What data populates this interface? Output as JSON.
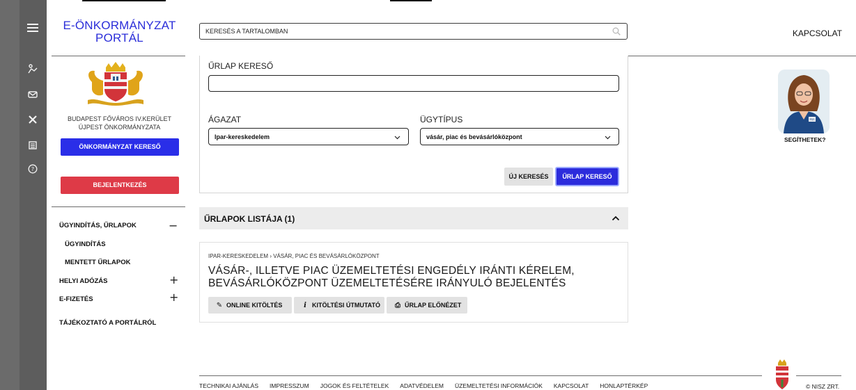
{
  "brand": {
    "line1": "E-ÖNKORMÁNYZAT",
    "line2": "PORTÁL"
  },
  "search": {
    "placeholder": "KERESÉS A TARTALOMBAN"
  },
  "header": {
    "contact": "KAPCSOLAT"
  },
  "sidebar_icons": [
    "menu-icon",
    "person-icon",
    "mail-icon",
    "tools-icon",
    "document-icon",
    "help-icon"
  ],
  "org": {
    "line1": "BUDAPEST FŐVÁROS IV.KERÜLET",
    "line2": "ÚJPEST ÖNKORMÁNYZATA"
  },
  "buttons": {
    "municipality_search": "ÖNKORMÁNYZAT KERESŐ",
    "login": "BEJELENTKEZÉS"
  },
  "nav": {
    "items": [
      {
        "label": "ÜGYINDÍTÁS, ŰRLAPOK",
        "sign": "−"
      },
      {
        "label": "ÜGYINDÍTÁS"
      },
      {
        "label": "MENTETT ŰRLAPOK"
      },
      {
        "label": "HELYI ADÓZÁS",
        "sign": "+"
      },
      {
        "label": "E-FIZETÉS",
        "sign": "+"
      },
      {
        "label": "TÁJÉKOZTATÓ A PORTÁLRÓL"
      }
    ]
  },
  "form": {
    "title": "ŰRLAP KERESŐ",
    "search_value": "",
    "sector_label": "ÁGAZAT",
    "sector_value": "Ipar-kereskedelem",
    "casetype_label": "ÜGYTÍPUS",
    "casetype_value": "vásár, piac és bevásárlóközpont",
    "new_search": "ÚJ KERESÉS",
    "form_search": "ŰRLAP KERESŐ"
  },
  "list": {
    "header": "ŰRLAPOK LISTÁJA (1)",
    "card": {
      "breadcrumb": "IPAR-KERESKEDELEM › VÁSÁR, PIAC ÉS BEVÁSÁRLÓKÖZPONT",
      "title": "VÁSÁR-, ILLETVE PIAC ÜZEMELTETÉSI ENGEDÉLY IRÁNTI KÉRELEM, BEVÁSÁRLÓKÖZPONT ÜZEMELTETÉSÉRE IRÁNYULÓ BEJELENTÉS",
      "actions": [
        "ONLINE KITÖLTÉS",
        "KITÖLTÉSI ÚTMUTATÓ",
        "ŰRLAP ELŐNÉZET"
      ]
    }
  },
  "assistant": {
    "label": "SEGÍTHETEK?",
    "badge": "MIA"
  },
  "footer": {
    "links": [
      "TECHNIKAI AJÁNLÁS",
      "IMPRESSZUM",
      "JOGOK ÉS FELTÉTELEK",
      "ADATVÉDELEM",
      "ÜZEMELTETÉSI INFORMÁCIÓK",
      "KAPCSOLAT",
      "HONLAPTÉRKÉP"
    ],
    "copyright": "© NISZ ZRT."
  },
  "colors": {
    "blue": "#2a2ee8",
    "red": "#de3a47",
    "sidebar": "#6b6b6b"
  }
}
